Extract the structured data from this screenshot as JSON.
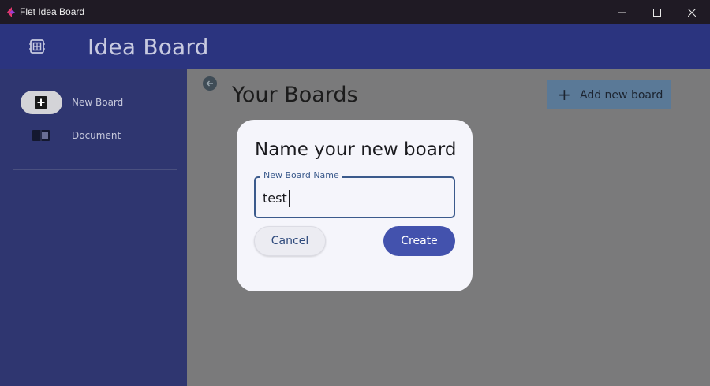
{
  "window": {
    "title": "Flet Idea Board",
    "controls": [
      "minimize-icon",
      "maximize-icon",
      "close-icon"
    ]
  },
  "appbar": {
    "title": "Idea Board",
    "leading_icon": "board-icon"
  },
  "sidebar": {
    "items": [
      {
        "label": "New Board",
        "icon": "add-box-icon",
        "selected": true
      },
      {
        "label": "Document",
        "icon": "book-icon",
        "selected": false
      }
    ]
  },
  "main": {
    "title": "Your Boards",
    "back_icon": "arrow-left-icon",
    "add_button_label": "Add new board"
  },
  "dialog": {
    "title": "Name your new board",
    "field_label": "New Board Name",
    "field_value": "test",
    "cancel_label": "Cancel",
    "create_label": "Create"
  },
  "colors": {
    "appbar": "#2b347f",
    "sidebar": "#2f3670",
    "accent": "#4352ad",
    "dialog_bg": "#f5f5fb"
  }
}
